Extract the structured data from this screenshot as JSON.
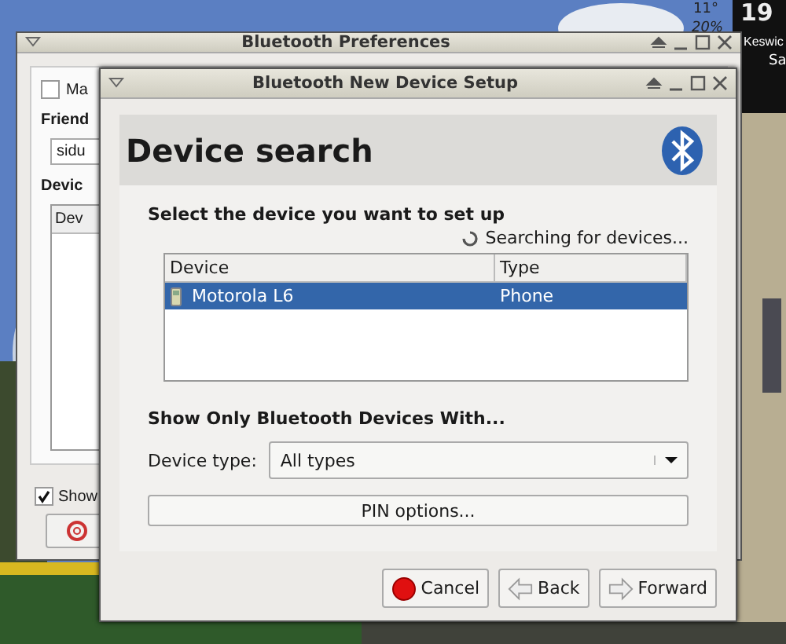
{
  "desktop": {
    "weather": {
      "temperature": "11°",
      "humidity": "20%",
      "day_number": "19",
      "location": "Keswic",
      "weekday": "Sa"
    }
  },
  "back_window": {
    "title": "Bluetooth Preferences",
    "option": {
      "label": "Ma",
      "checked": false
    },
    "friendly_label": "Friend",
    "name_field": {
      "value": "sidu"
    },
    "devices_label": "Devic",
    "list_header": "Dev",
    "show_option": {
      "label": "Show",
      "checked": true
    }
  },
  "dialog": {
    "title": "Bluetooth New Device Setup",
    "heading": "Device search",
    "prompt": "Select the device you want to set up",
    "status": "Searching for devices...",
    "table": {
      "columns": [
        "Device",
        "Type"
      ],
      "rows": [
        {
          "device": "Motorola L6",
          "type": "Phone",
          "selected": true
        }
      ]
    },
    "filter_heading": "Show Only Bluetooth Devices With...",
    "device_type": {
      "label": "Device type:",
      "value": "All types"
    },
    "pin_button": "PIN options...",
    "buttons": [
      {
        "label": "Cancel",
        "kind": "cancel"
      },
      {
        "label": "Back",
        "kind": "back"
      },
      {
        "label": "Forward",
        "kind": "forward"
      }
    ]
  }
}
